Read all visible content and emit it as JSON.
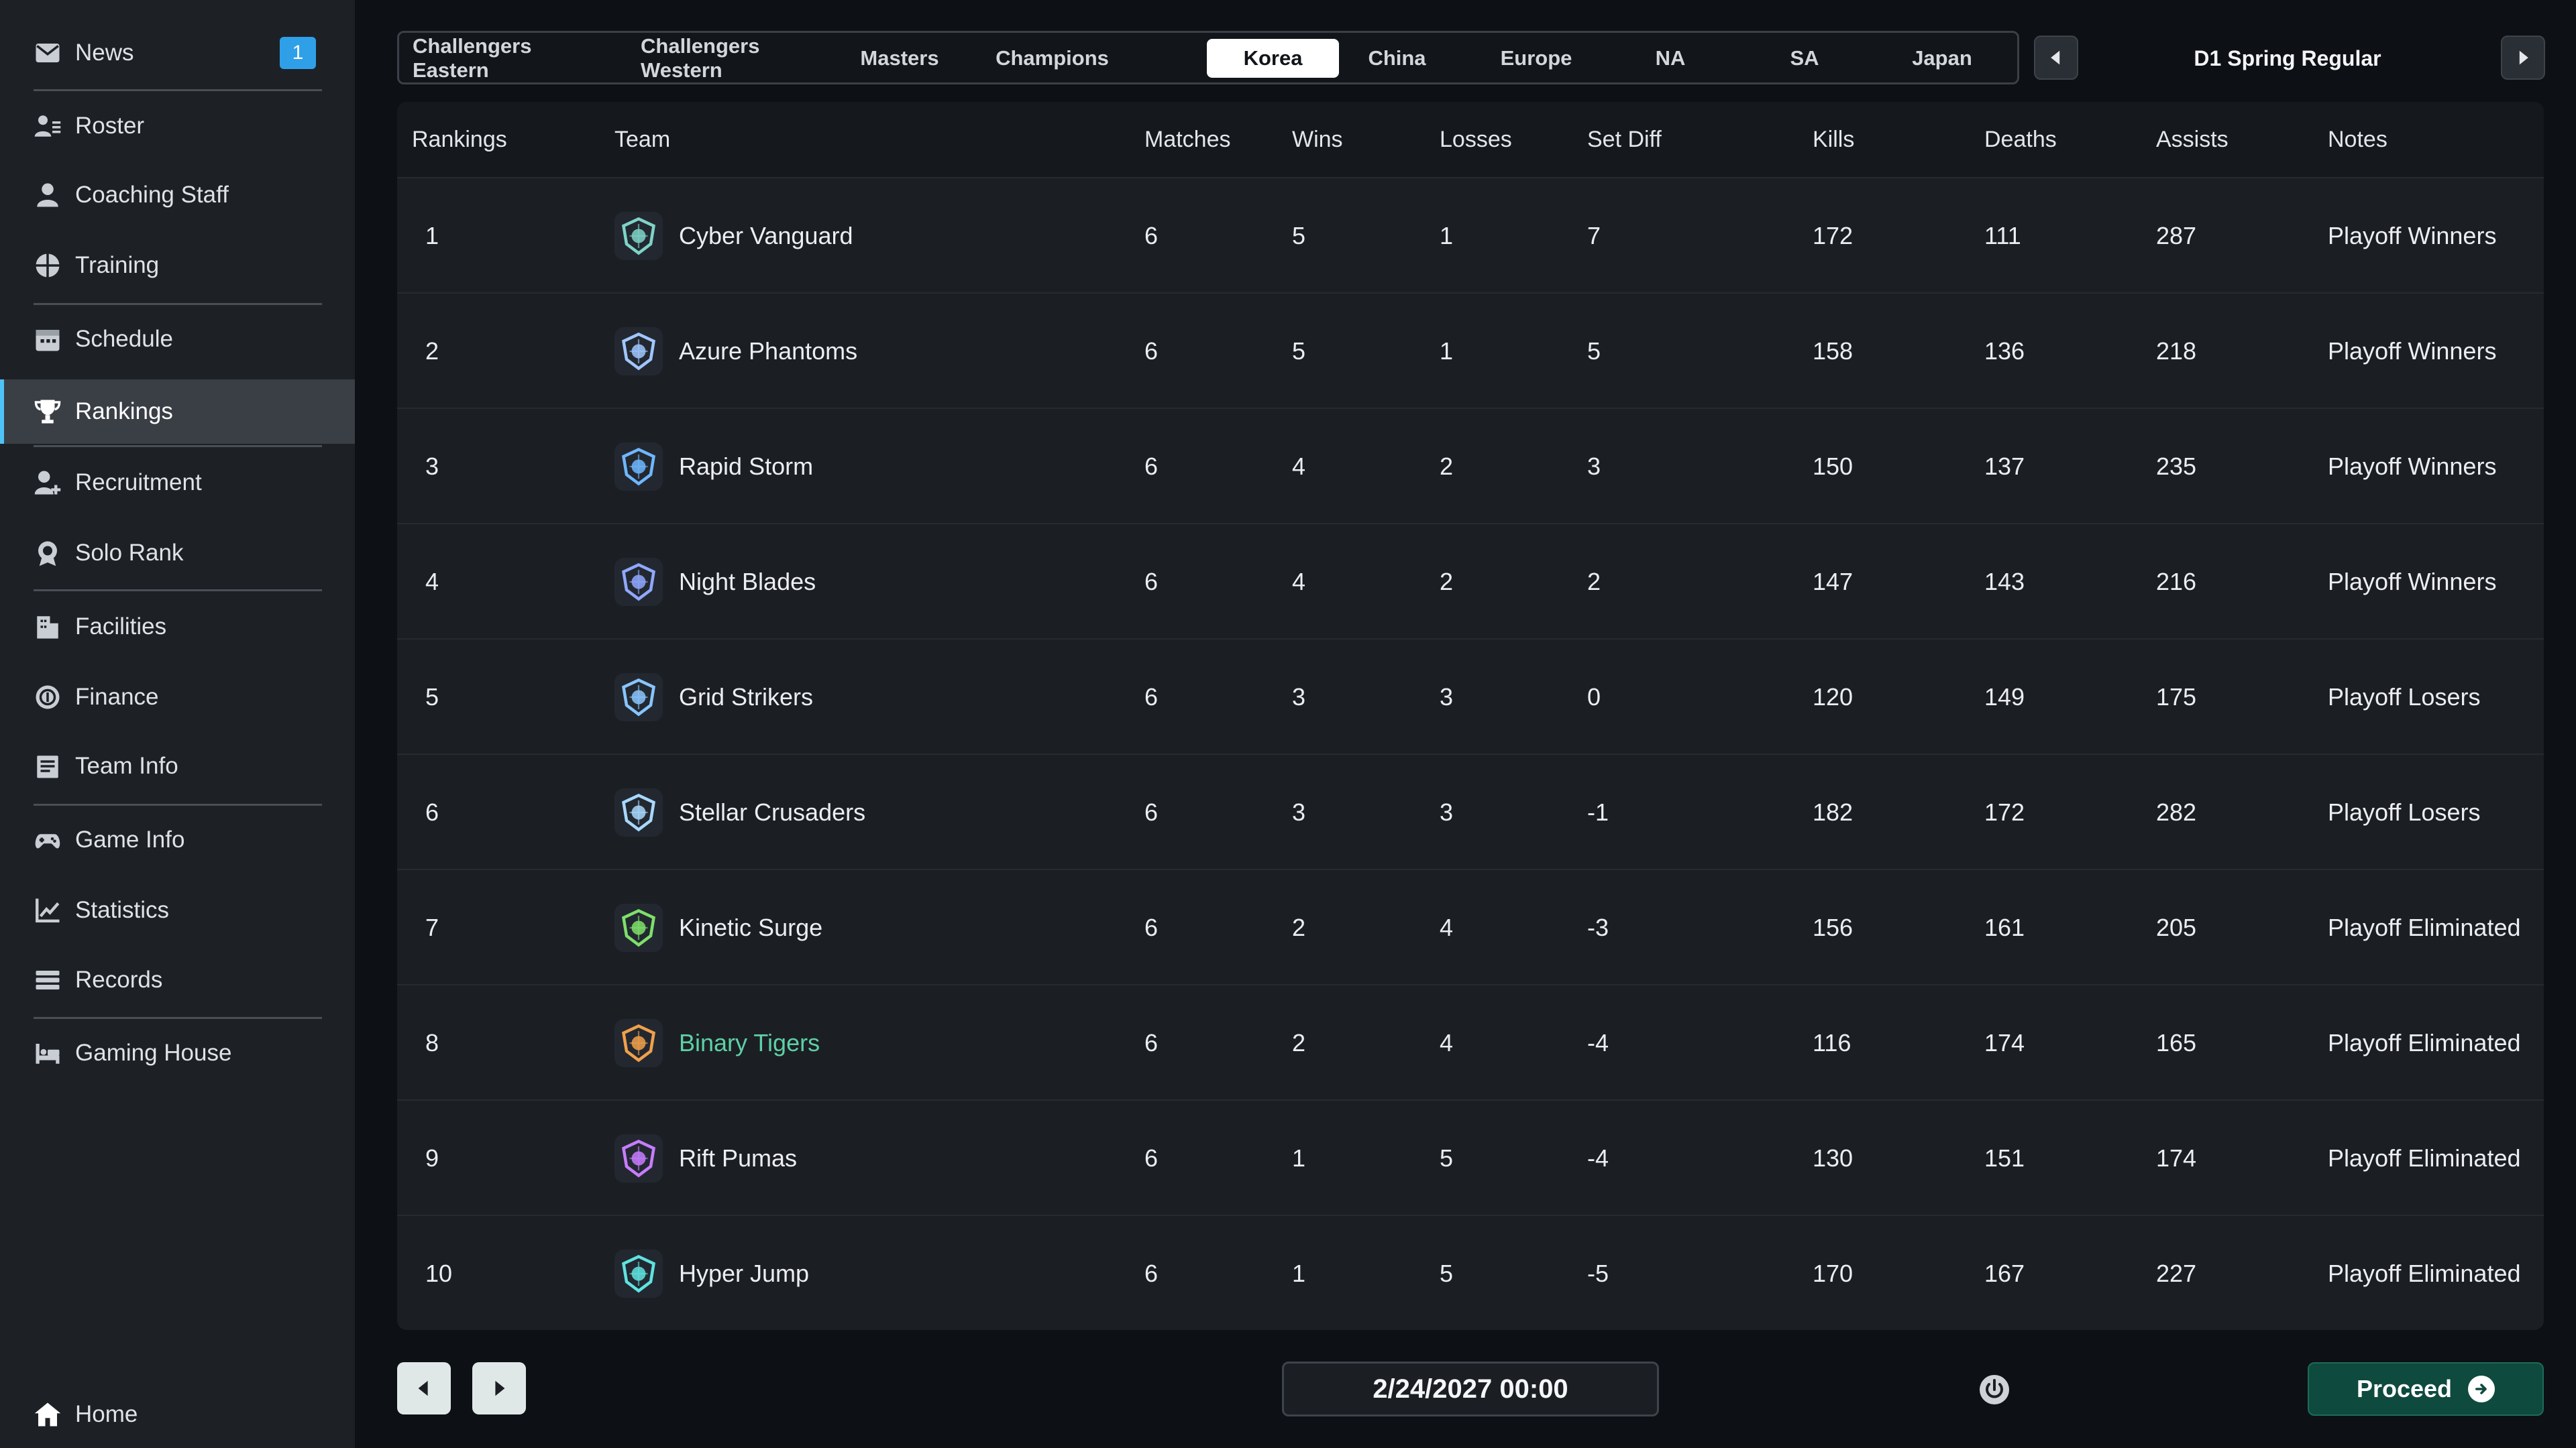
{
  "sidebar": {
    "items": [
      {
        "key": "news",
        "label": "News",
        "icon": "envelope-icon",
        "badge": "1"
      },
      {
        "key": "roster",
        "label": "Roster",
        "icon": "roster-icon"
      },
      {
        "key": "coaching",
        "label": "Coaching Staff",
        "icon": "coach-icon"
      },
      {
        "key": "training",
        "label": "Training",
        "icon": "training-icon"
      },
      {
        "key": "schedule",
        "label": "Schedule",
        "icon": "calendar-icon"
      },
      {
        "key": "rankings",
        "label": "Rankings",
        "icon": "trophy-icon",
        "active": true
      },
      {
        "key": "recruitment",
        "label": "Recruitment",
        "icon": "recruit-icon"
      },
      {
        "key": "solo",
        "label": "Solo Rank",
        "icon": "medal-icon"
      },
      {
        "key": "facilities",
        "label": "Facilities",
        "icon": "building-icon"
      },
      {
        "key": "finance",
        "label": "Finance",
        "icon": "coins-icon"
      },
      {
        "key": "teaminfo",
        "label": "Team Info",
        "icon": "document-icon"
      },
      {
        "key": "gameinfo",
        "label": "Game Info",
        "icon": "gamepad-icon"
      },
      {
        "key": "statistics",
        "label": "Statistics",
        "icon": "chart-icon"
      },
      {
        "key": "records",
        "label": "Records",
        "icon": "list-icon"
      },
      {
        "key": "gaminghouse",
        "label": "Gaming House",
        "icon": "bed-icon"
      }
    ],
    "home_label": "Home"
  },
  "tabs": [
    {
      "label": "Challengers Eastern"
    },
    {
      "label": "Challengers Western"
    },
    {
      "label": "Masters"
    },
    {
      "label": "Champions"
    },
    {
      "label": "Korea",
      "active": true
    },
    {
      "label": "China"
    },
    {
      "label": "Europe"
    },
    {
      "label": "NA"
    },
    {
      "label": "SA"
    },
    {
      "label": "Japan"
    }
  ],
  "season": {
    "title": "D1 Spring Regular"
  },
  "table": {
    "headers": {
      "rank": "Rankings",
      "team": "Team",
      "matches": "Matches",
      "wins": "Wins",
      "losses": "Losses",
      "setdiff": "Set Diff",
      "kills": "Kills",
      "deaths": "Deaths",
      "assists": "Assists",
      "notes": "Notes"
    },
    "rows": [
      {
        "rank": "1",
        "team": "Cyber Vanguard",
        "matches": "6",
        "wins": "5",
        "losses": "1",
        "setdiff": "7",
        "kills": "172",
        "deaths": "111",
        "assists": "287",
        "notes": "Playoff Winners",
        "logo_color": "#7fd3c8"
      },
      {
        "rank": "2",
        "team": "Azure Phantoms",
        "matches": "6",
        "wins": "5",
        "losses": "1",
        "setdiff": "5",
        "kills": "158",
        "deaths": "136",
        "assists": "218",
        "notes": "Playoff Winners",
        "logo_color": "#9fc7ff"
      },
      {
        "rank": "3",
        "team": "Rapid Storm",
        "matches": "6",
        "wins": "4",
        "losses": "2",
        "setdiff": "3",
        "kills": "150",
        "deaths": "137",
        "assists": "235",
        "notes": "Playoff Winners",
        "logo_color": "#6fb7ff"
      },
      {
        "rank": "4",
        "team": "Night Blades",
        "matches": "6",
        "wins": "4",
        "losses": "2",
        "setdiff": "2",
        "kills": "147",
        "deaths": "143",
        "assists": "216",
        "notes": "Playoff Winners",
        "logo_color": "#8fa8ff"
      },
      {
        "rank": "5",
        "team": "Grid Strikers",
        "matches": "6",
        "wins": "3",
        "losses": "3",
        "setdiff": "0",
        "kills": "120",
        "deaths": "149",
        "assists": "175",
        "notes": "Playoff Losers",
        "logo_color": "#89c5ff"
      },
      {
        "rank": "6",
        "team": "Stellar Crusaders",
        "matches": "6",
        "wins": "3",
        "losses": "3",
        "setdiff": "-1",
        "kills": "182",
        "deaths": "172",
        "assists": "282",
        "notes": "Playoff Losers",
        "logo_color": "#a8d8ff"
      },
      {
        "rank": "7",
        "team": "Kinetic Surge",
        "matches": "6",
        "wins": "2",
        "losses": "4",
        "setdiff": "-3",
        "kills": "156",
        "deaths": "161",
        "assists": "205",
        "notes": "Playoff Eliminated",
        "logo_color": "#7ee06a"
      },
      {
        "rank": "8",
        "team": "Binary Tigers",
        "matches": "6",
        "wins": "2",
        "losses": "4",
        "setdiff": "-4",
        "kills": "116",
        "deaths": "174",
        "assists": "165",
        "notes": "Playoff Eliminated",
        "logo_color": "#f0a04b",
        "highlight": true
      },
      {
        "rank": "9",
        "team": "Rift Pumas",
        "matches": "6",
        "wins": "1",
        "losses": "5",
        "setdiff": "-4",
        "kills": "130",
        "deaths": "151",
        "assists": "174",
        "notes": "Playoff Eliminated",
        "logo_color": "#c77dff"
      },
      {
        "rank": "10",
        "team": "Hyper Jump",
        "matches": "6",
        "wins": "1",
        "losses": "5",
        "setdiff": "-5",
        "kills": "170",
        "deaths": "167",
        "assists": "227",
        "notes": "Playoff Eliminated",
        "logo_color": "#5fe3e0"
      }
    ]
  },
  "footer": {
    "date": "2/24/2027 00:00",
    "proceed_label": "Proceed"
  },
  "colors": {
    "accent": "#4fc3f7",
    "highlight_team": "#5fd0a5",
    "proceed_bg": "#0f4a3e",
    "badge": "#2f9fe8"
  }
}
